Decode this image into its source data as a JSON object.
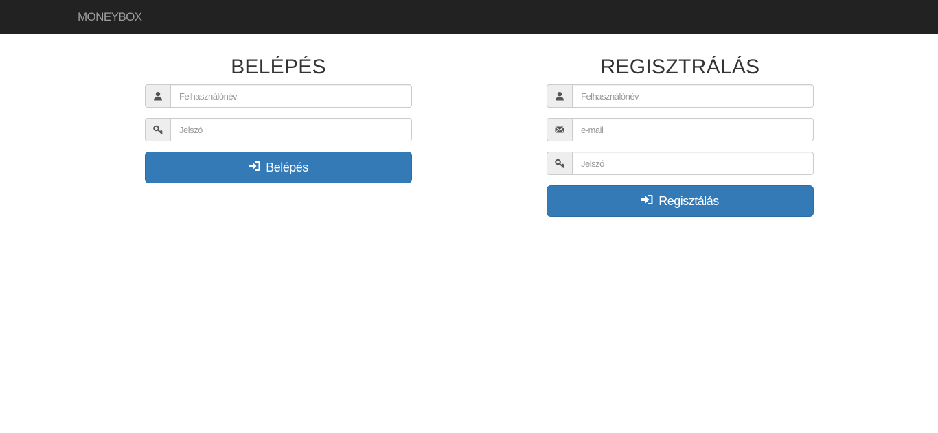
{
  "navbar": {
    "brand": "MONEYBOX"
  },
  "login": {
    "title": "BELÉPÉS",
    "username_placeholder": "Felhasználónév",
    "password_placeholder": "Jelszó",
    "submit_label": "Belépés"
  },
  "register": {
    "title": "REGISZTRÁLÁS",
    "username_placeholder": "Felhasználónév",
    "email_placeholder": "e-mail",
    "password_placeholder": "Jelszó",
    "submit_label": "Regisztálás"
  },
  "colors": {
    "navbar_bg": "#222222",
    "brand_text": "#9d9d9d",
    "primary_button": "#337ab7",
    "addon_bg": "#eeeeee"
  },
  "icons": {
    "username": "user-icon",
    "email": "envelope-icon",
    "password": "key-icon",
    "submit": "log-in-icon"
  }
}
